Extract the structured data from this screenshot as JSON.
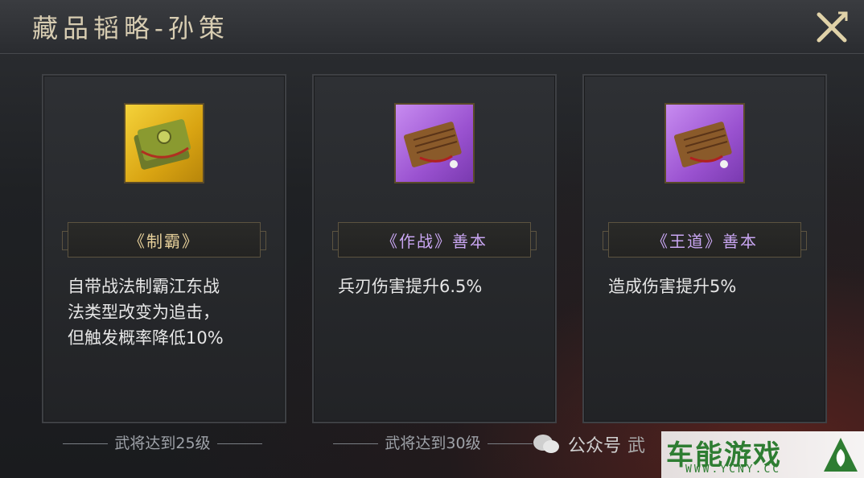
{
  "header": {
    "title": "藏品韬略-孙策"
  },
  "cards": [
    {
      "name": "《制霸》",
      "icon": "gold-scroll-book-icon",
      "desc_lines": [
        "自带战法制霸江东战",
        "法类型改变为追击，",
        "但触发概率降低10%"
      ],
      "requirement": "武将达到25级",
      "rarity_color": "#f0c020"
    },
    {
      "name": "《作战》善本",
      "icon": "purple-scroll-book-icon",
      "desc_lines": [
        "兵刃伤害提升6.5%"
      ],
      "requirement": "武将达到30级",
      "rarity_color": "#a560e0"
    },
    {
      "name": "《王道》善本",
      "icon": "purple-scroll-book-icon",
      "desc_lines": [
        "造成伤害提升5%"
      ],
      "rarity_color": "#a560e0"
    }
  ],
  "watermark": {
    "wechat": "公众号",
    "partial": "武",
    "brand": "车能游戏",
    "url": "WWW.YCNY.CC"
  }
}
